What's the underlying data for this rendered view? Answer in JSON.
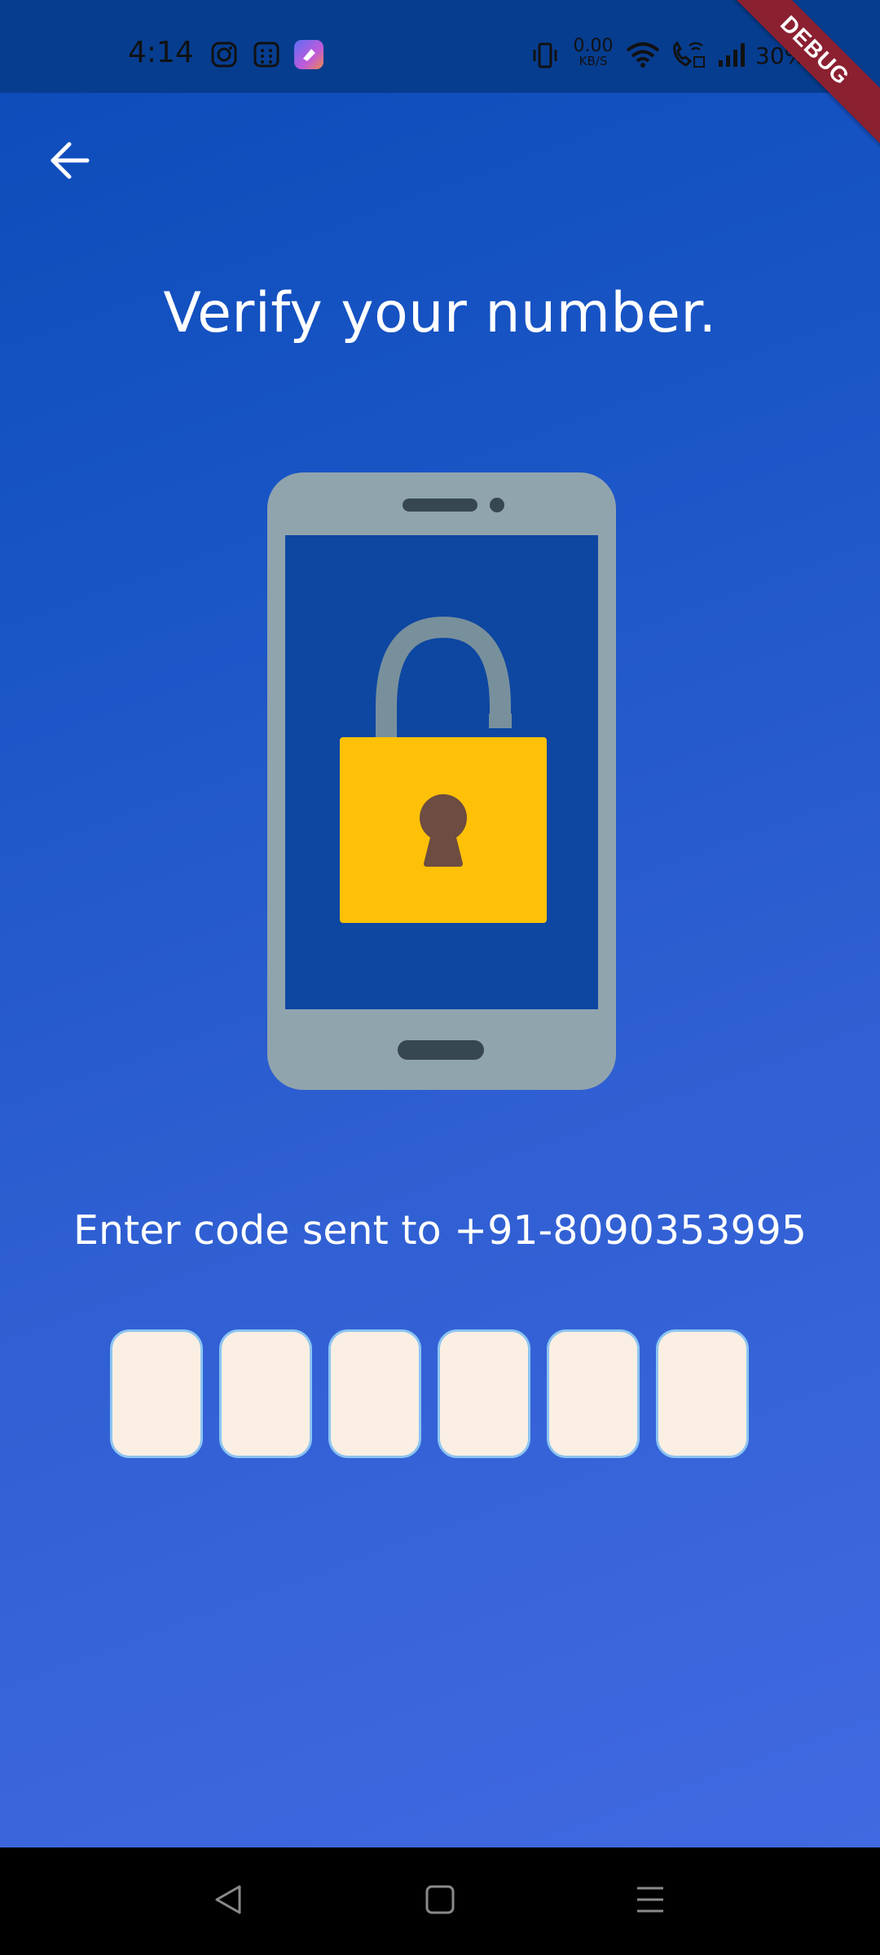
{
  "status_bar": {
    "time": "4:14",
    "net_speed_value": "0.00",
    "net_speed_unit": "KB/S",
    "battery": "30%",
    "icons": [
      "instagram-icon",
      "calculator-icon",
      "app-icon",
      "vibrate-icon",
      "wifi-icon",
      "wifi-call-icon",
      "signal-icon"
    ]
  },
  "debug_banner": "DEBUG",
  "header": {
    "back_icon": "arrow-left-icon"
  },
  "main": {
    "title": "Verify your number.",
    "illustration": "phone-unlock-icon",
    "subtitle": "Enter code sent to +91-8090353995",
    "otp_boxes": [
      "",
      "",
      "",
      "",
      "",
      ""
    ]
  },
  "nav_bar": {
    "icons": [
      "back-triangle-icon",
      "home-square-icon",
      "menu-lines-icon"
    ]
  },
  "colors": {
    "status_bar": "#073d8f",
    "gradient_start": "#0b4bb8",
    "gradient_end": "#4169e1",
    "otp_fill": "#fbefe3",
    "otp_border": "#8cc4f2",
    "lock_yellow": "#ffc107",
    "phone_gray": "#90a4ae",
    "debug_red": "#8b2030"
  }
}
